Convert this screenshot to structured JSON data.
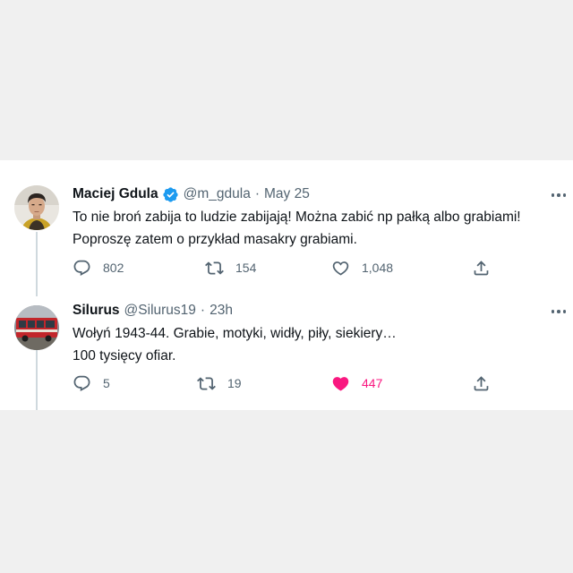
{
  "tweets": [
    {
      "author_name": "Maciej Gdula",
      "handle": "@m_gdula",
      "separator": "·",
      "time": "May 25",
      "verified": true,
      "text_lines": [
        "To nie broń zabija to ludzie zabijają! Można zabić np pałką albo grabiami!",
        "Poproszę zatem o przykład masakry grabiami."
      ],
      "replies": "802",
      "retweets": "154",
      "likes": "1,048",
      "liked": false
    },
    {
      "author_name": "Silurus",
      "handle": "@Silurus19",
      "separator": "·",
      "time": "23h",
      "verified": false,
      "text_lines": [
        "Wołyń 1943-44. Grabie, motyki, widły, piły, siekiery…",
        "100 tysięcy ofiar."
      ],
      "replies": "5",
      "retweets": "19",
      "likes": "447",
      "liked": true
    }
  ],
  "icons": {
    "reply": "reply-icon",
    "retweet": "retweet-icon",
    "like": "heart-icon",
    "share": "share-icon",
    "more": "more-options-icon",
    "verified": "verified-badge-icon"
  },
  "colors": {
    "verified_blue": "#1d9bf0",
    "like_pink": "#f91880",
    "secondary_text": "#536471",
    "thread_line": "#cfd9de"
  }
}
